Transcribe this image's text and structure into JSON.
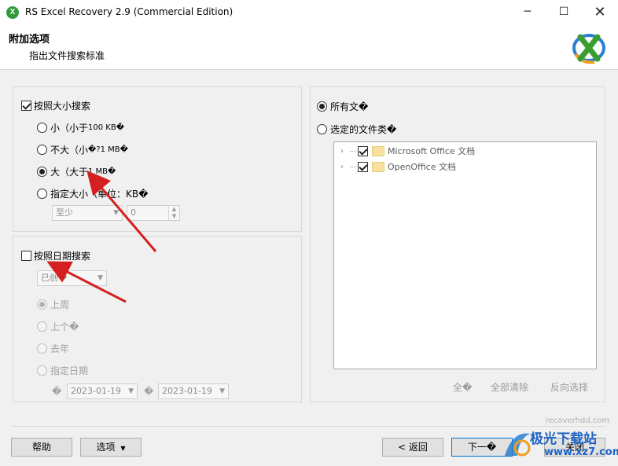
{
  "window": {
    "title": "RS Excel Recovery 2.9 (Commercial Edition)",
    "app_icon_glyph": "X",
    "minimize_glyph": "─",
    "maximize_glyph": "☐",
    "close_glyph": "✕"
  },
  "header": {
    "title": "附加选项",
    "subtitle": "指出文件搜索标准"
  },
  "size_search": {
    "label": "按照大小搜索",
    "checked": true,
    "options": [
      {
        "label": "小（小于",
        "suffix": "100 KB�",
        "selected": false
      },
      {
        "label": "不大（小",
        "suffix": "�?1 MB�",
        "selected": false
      },
      {
        "label": "大（大于",
        "suffix": "1 MB�",
        "selected": true
      },
      {
        "label": "指定大小（单位：KB�",
        "suffix": "",
        "selected": false
      }
    ],
    "min_select_value": "至少",
    "min_value": "0"
  },
  "date_search": {
    "label": "按照日期搜索",
    "checked": false,
    "type_select_value": "已创�",
    "options": [
      {
        "label": "上周",
        "selected": true
      },
      {
        "label": "上个�",
        "selected": false
      },
      {
        "label": "去年",
        "selected": false
      },
      {
        "label": "指定日期",
        "selected": false
      }
    ],
    "date_prefix": "�",
    "from_date": "2023-01-19",
    "to_prefix": "�",
    "to_date": "2023-01-19"
  },
  "file_types": {
    "all_label": "所有文�",
    "selected_label": "选定的文件类�",
    "all_selected": true,
    "tree": [
      {
        "label": "Microsoft Office 文档",
        "checked": true
      },
      {
        "label": "OpenOffice 文档",
        "checked": true
      }
    ],
    "select_all": "全�",
    "clear_all": "全部清除",
    "invert": "反向选择"
  },
  "footer": {
    "url": "recoverhdd.com",
    "help": "帮助",
    "options": "选项",
    "options_arrow": "▼",
    "back": "< 返回",
    "next": "下一�",
    "close": "关闭"
  },
  "watermark": {
    "text": "极光下载站",
    "url": "www.xz7.com"
  },
  "colors": {
    "accent": "#0078d7",
    "arrow_red": "#d42020",
    "logo_green": "#3a9e2f",
    "logo_blue": "#2a7fd0",
    "logo_orange": "#f0a020"
  }
}
